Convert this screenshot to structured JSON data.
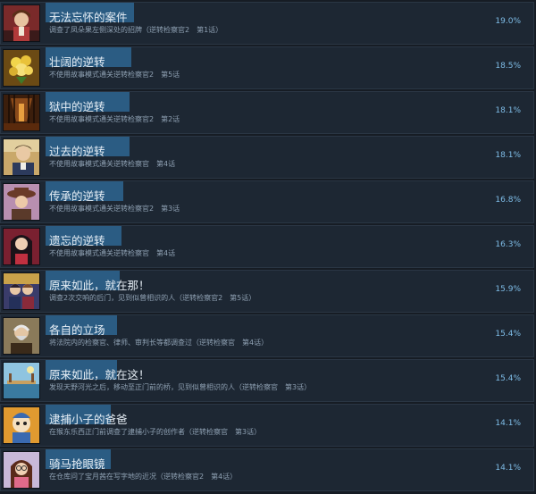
{
  "achievements": [
    {
      "title": "无法忘怀的案件",
      "desc": "调查了凤朵果左侧深处的招牌（逆转检察官2　第1话）",
      "pct": "19.0%",
      "progress": 0.19,
      "icon": "portrait-red-icon"
    },
    {
      "title": "壮阔的逆转",
      "desc": "不使用故事模式通关逆转检察官2　第5话",
      "pct": "18.5%",
      "progress": 0.185,
      "icon": "bouquet-icon"
    },
    {
      "title": "狱中的逆转",
      "desc": "不使用故事模式通关逆转检察官2　第2话",
      "pct": "18.1%",
      "progress": 0.181,
      "icon": "prison-corridor-icon"
    },
    {
      "title": "过去的逆转",
      "desc": "不使用故事模式通关逆转检察官　第4话",
      "pct": "18.1%",
      "progress": 0.181,
      "icon": "portrait-man-icon"
    },
    {
      "title": "传承的逆转",
      "desc": "不使用故事模式通关逆转检察官2　第3话",
      "pct": "16.8%",
      "progress": 0.168,
      "icon": "portrait-hat-icon"
    },
    {
      "title": "遗忘的逆转",
      "desc": "不使用故事模式通关逆转检察官　第4话",
      "pct": "16.3%",
      "progress": 0.163,
      "icon": "portrait-woman-icon"
    },
    {
      "title": "原来如此，就在那！",
      "desc": "调查2次交响的后门，见到似曾相识的人（逆转检察官2　第5话）",
      "pct": "15.9%",
      "progress": 0.159,
      "icon": "portrait-duo-icon"
    },
    {
      "title": "各自的立场",
      "desc": "将法院内的检察官、律师、审判长等都调查过（逆转检察官　第4话）",
      "pct": "15.4%",
      "progress": 0.154,
      "icon": "portrait-elder-icon"
    },
    {
      "title": "原来如此，就在这！",
      "desc": "发现天野河光之后，移动至正门前的桥，见到似曾相识的人（逆转检察官　第3话）",
      "pct": "15.4%",
      "progress": 0.154,
      "icon": "bridge-scene-icon"
    },
    {
      "title": "逮捕小子的爸爸",
      "desc": "在猴东乐西正门前调查了逮捕小子的创作者（逆转检察官　第3话）",
      "pct": "14.1%",
      "progress": 0.141,
      "icon": "mascot-icon"
    },
    {
      "title": "骑马抢眼镜",
      "desc": "在仓库问了宝月茜在写字地的近况（逆转检察官2　第4话）",
      "pct": "14.1%",
      "progress": 0.141,
      "icon": "portrait-glasses-icon"
    }
  ]
}
